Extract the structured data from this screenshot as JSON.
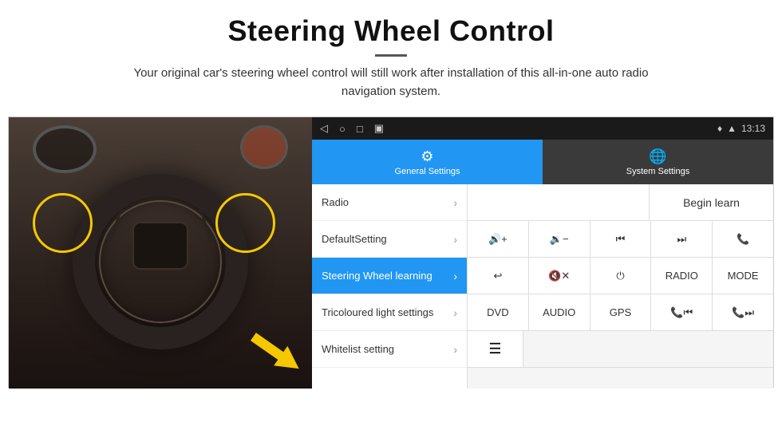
{
  "header": {
    "title": "Steering Wheel Control",
    "subtitle": "Your original car's steering wheel control will still work after installation of this all-in-one auto radio navigation system."
  },
  "status_bar": {
    "time": "13:13",
    "icons": [
      "◁",
      "○",
      "□",
      "▣"
    ]
  },
  "tabs": [
    {
      "id": "general",
      "label": "General Settings",
      "icon": "⚙"
    },
    {
      "id": "system",
      "label": "System Settings",
      "icon": "🌐"
    }
  ],
  "menu": {
    "items": [
      {
        "label": "Radio",
        "active": false
      },
      {
        "label": "DefaultSetting",
        "active": false
      },
      {
        "label": "Steering Wheel learning",
        "active": true
      },
      {
        "label": "Tricoloured light settings",
        "active": false
      },
      {
        "label": "Whitelist setting",
        "active": false
      }
    ]
  },
  "right_panel": {
    "begin_learn_label": "Begin learn",
    "button_rows": [
      [
        {
          "label": "🔊+",
          "type": "icon"
        },
        {
          "label": "🔉−",
          "type": "icon"
        },
        {
          "label": "⏮",
          "type": "icon"
        },
        {
          "label": "⏭",
          "type": "icon"
        },
        {
          "label": "📞",
          "type": "icon"
        }
      ],
      [
        {
          "label": "↩",
          "type": "icon"
        },
        {
          "label": "🔇×",
          "type": "icon"
        },
        {
          "label": "⏻",
          "type": "icon"
        },
        {
          "label": "RADIO",
          "type": "text"
        },
        {
          "label": "MODE",
          "type": "text"
        }
      ],
      [
        {
          "label": "DVD",
          "type": "text"
        },
        {
          "label": "AUDIO",
          "type": "text"
        },
        {
          "label": "GPS",
          "type": "text"
        },
        {
          "label": "📞⏮",
          "type": "icon"
        },
        {
          "label": "📞⏭",
          "type": "icon"
        }
      ]
    ],
    "last_row_icon": "📋"
  }
}
